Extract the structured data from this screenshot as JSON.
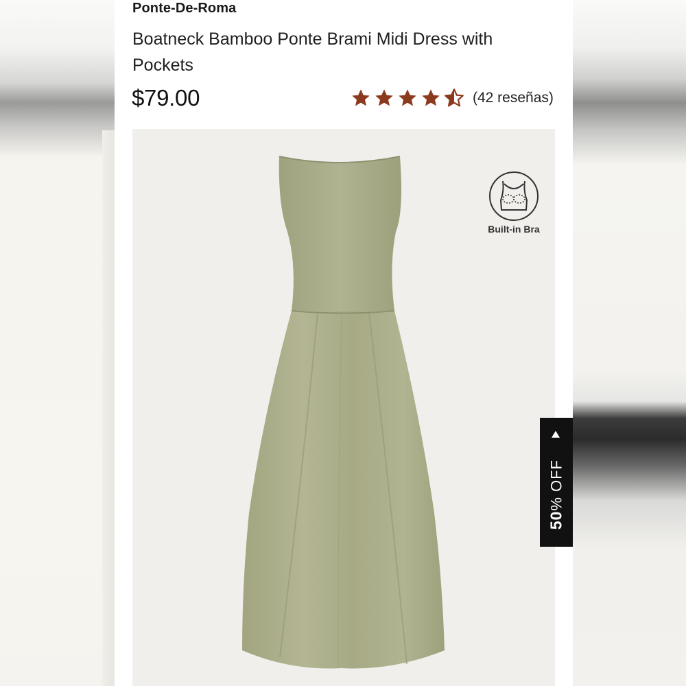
{
  "product": {
    "brand": "Ponte-De-Roma",
    "title": "Boatneck Bamboo Ponte Brami Midi Dress with Pockets",
    "price": "$79.00",
    "rating": {
      "value": 4.5,
      "max": 5,
      "reviews_label": "(42 reseñas)"
    },
    "badge": {
      "icon": "built-in-bra-icon",
      "label": "Built-in Bra"
    },
    "image": {
      "description_icon": "dress-photo"
    }
  },
  "discount_tab": {
    "percent": "50",
    "suffix": "% OFF",
    "icon": "caret-left-icon"
  },
  "colors": {
    "star": "#8b3a1e",
    "dress": "#a9ad88",
    "image_bg": "#f0efeb",
    "tab_bg": "#111111"
  }
}
